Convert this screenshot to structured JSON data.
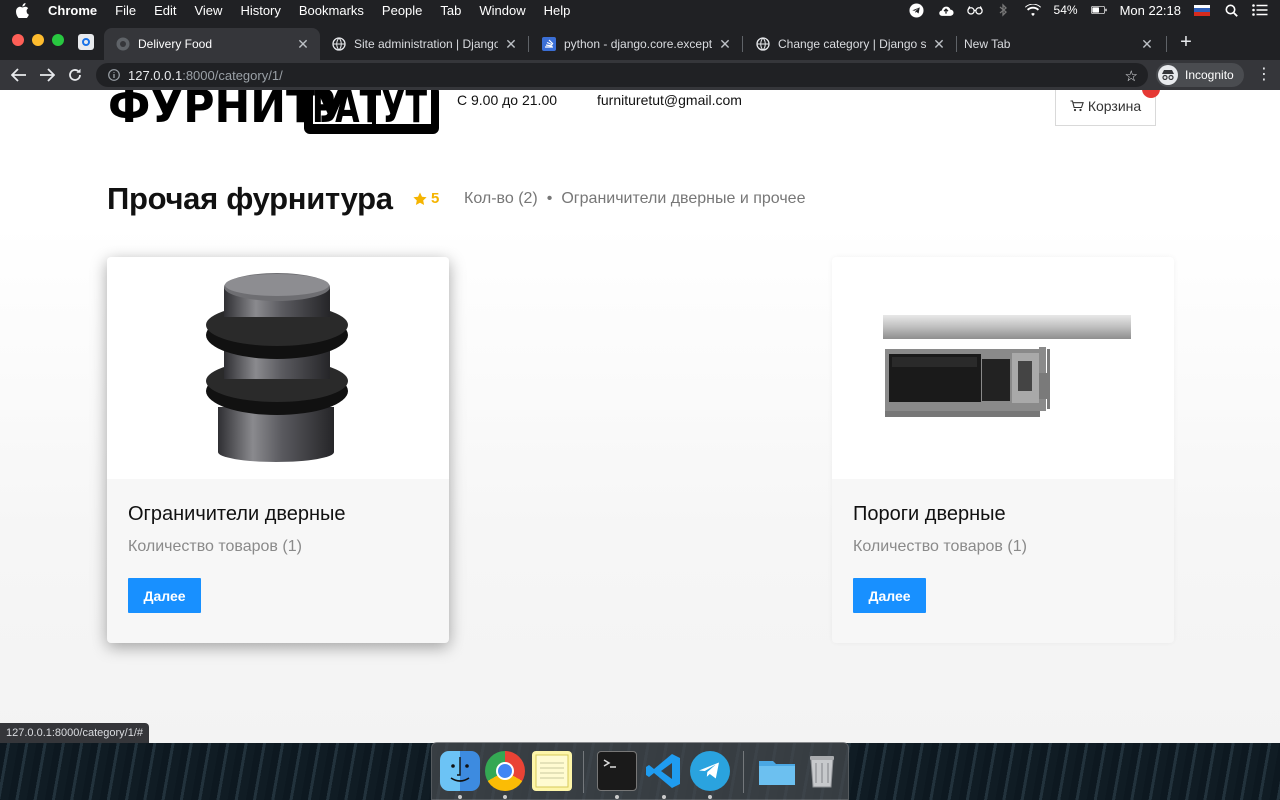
{
  "menubar": {
    "app": "Chrome",
    "menus": [
      "File",
      "Edit",
      "View",
      "History",
      "Bookmarks",
      "People",
      "Tab",
      "Window",
      "Help"
    ],
    "battery": "54%",
    "clock": "Mon 22:18"
  },
  "tabs": [
    {
      "title": "Delivery Food",
      "active": true
    },
    {
      "title": "Site administration | Django site"
    },
    {
      "title": "python - django.core.exceptions"
    },
    {
      "title": "Change category | Django site"
    },
    {
      "title": "New Tab"
    }
  ],
  "omnibox": {
    "host": "127.0.0.1",
    "path": ":8000/category/1/"
  },
  "profile": {
    "label": "Incognito"
  },
  "site": {
    "hours": "С 9.00 до 21.00",
    "email": "furnituretut@gmail.com",
    "cart_label": "Корзина",
    "logo_text": "ФУРНИТУРА ТУТ"
  },
  "category": {
    "title": "Прочая фурнитура",
    "rating": "5",
    "count": "Кол-во (2)",
    "description": "Ограничители дверные и прочее"
  },
  "cards": [
    {
      "name": "Ограничители дверные",
      "count": "Количество товаров (1)",
      "button": "Далее"
    },
    {
      "name": "Пороги дверные",
      "count": "Количество товаров (1)",
      "button": "Далее"
    }
  ],
  "status_url": "127.0.0.1:8000/category/1/#",
  "colors": {
    "accent": "#1890ff",
    "rating": "#f5b400",
    "chrome_dark": "#202124",
    "chrome_toolbar": "#35363a"
  },
  "dock": {
    "apps": [
      "finder-icon",
      "chrome-icon",
      "notes-icon",
      "terminal-icon",
      "vscode-icon",
      "telegram-icon",
      "folder-icon",
      "trash-icon"
    ]
  }
}
